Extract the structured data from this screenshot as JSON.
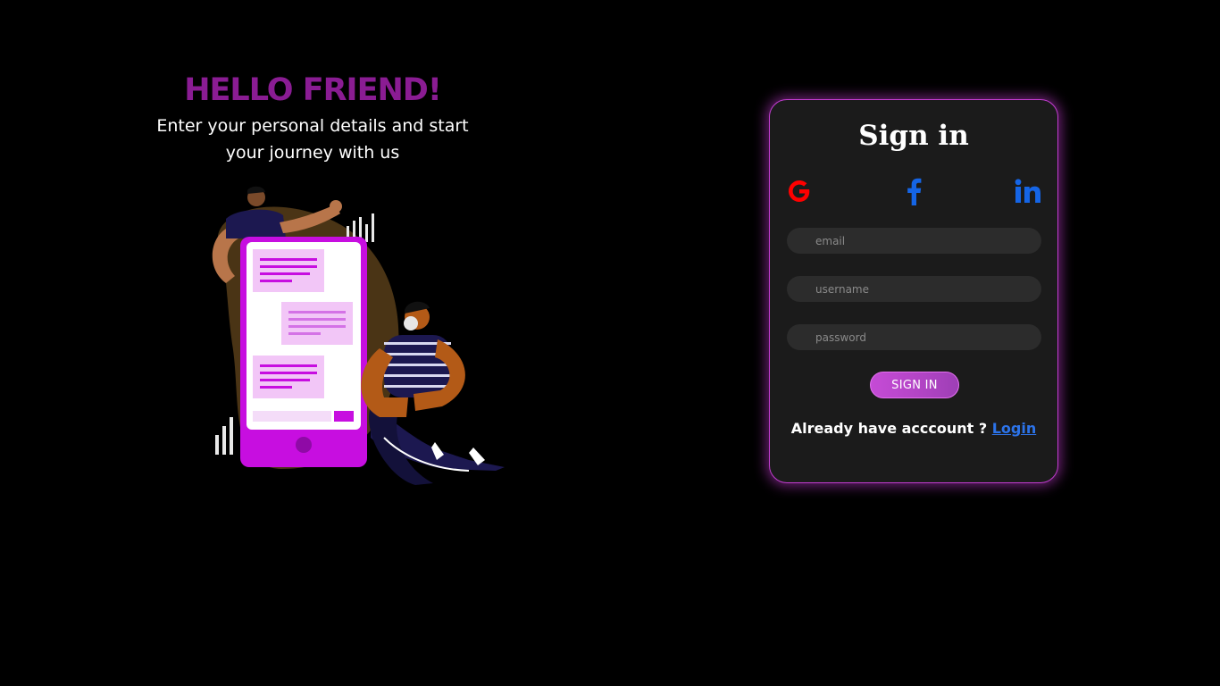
{
  "hero": {
    "title": "HELLO FRIEND!",
    "subtitle_line1": "Enter your personal details and start",
    "subtitle_line2": "your journey with us"
  },
  "illustration": {
    "icon": "people-with-phone-chat-illustration",
    "phone_color": "#c70ee0",
    "blob_color": "#4a3415"
  },
  "signin_card": {
    "title": "Sign in",
    "social": [
      {
        "icon": "google-icon",
        "color": "#ff0000"
      },
      {
        "icon": "facebook-icon",
        "color": "#1565e6"
      },
      {
        "icon": "linkedin-icon",
        "color": "#1565e6"
      }
    ],
    "fields": {
      "email_placeholder": "email",
      "username_placeholder": "username",
      "password_placeholder": "password"
    },
    "submit_label": "SIGN IN",
    "footer_text": "Already have acccount ?",
    "login_link": "Login"
  },
  "colors": {
    "background": "#000000",
    "accent": "#c23cd0",
    "title": "#8a1c93",
    "card": "#1b1b1b",
    "link": "#2c73e9"
  }
}
